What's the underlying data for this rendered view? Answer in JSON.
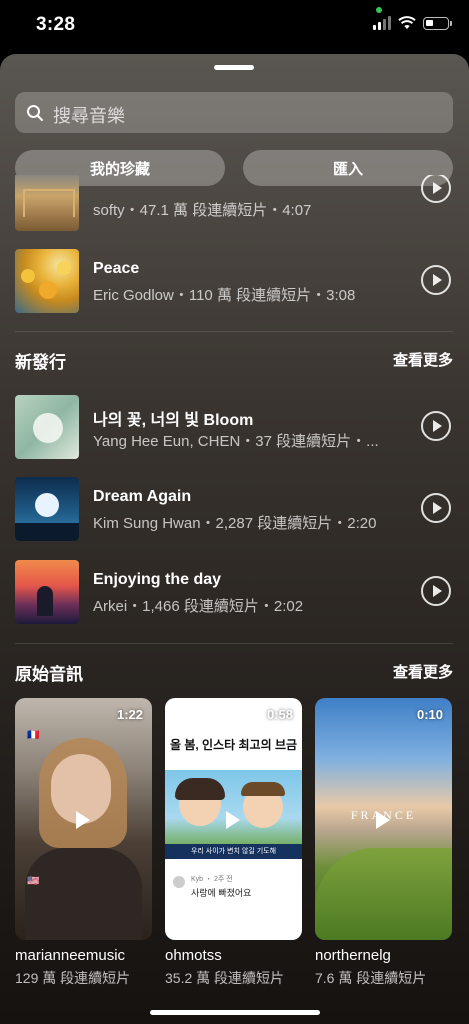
{
  "status": {
    "time": "3:28"
  },
  "search": {
    "placeholder": "搜尋音樂"
  },
  "segments": {
    "favorites": "我的珍藏",
    "import": "匯入"
  },
  "top_tracks": [
    {
      "title": "",
      "subtitle": "softy・47.1 萬 段連續短片・4:07"
    },
    {
      "title": "Peace",
      "subtitle": "Eric Godlow・110 萬 段連續短片・3:08"
    }
  ],
  "new_releases": {
    "title": "新發行",
    "see_more": "查看更多",
    "tracks": [
      {
        "title": "나의 꽃, 너의 빛 Bloom",
        "subtitle": "Yang Hee Eun, CHEN・37 段連續短片・..."
      },
      {
        "title": "Dream Again",
        "subtitle": "Kim Sung Hwan・2,287 段連續短片・2:20"
      },
      {
        "title": "Enjoying the day",
        "subtitle": "Arkei・1,466 段連續短片・2:02"
      }
    ]
  },
  "original_audio": {
    "title": "原始音訊",
    "see_more": "查看更多",
    "reels": [
      {
        "duration": "1:22",
        "name": "marianneemusic",
        "count": "129 萬 段連續短片",
        "flag_top": "🇫🇷",
        "flag_bottom": "🇺🇸"
      },
      {
        "duration": "0:58",
        "name": "ohmotss",
        "count": "35.2 萬 段連續短片",
        "headline": "올 봄, 인스타 최고의 브금",
        "caption": "우리 사이가 변치 않길 기도해",
        "comment": "사랑에 빠졌어요",
        "comment_user": "Kyb ・ 2주 전"
      },
      {
        "duration": "0:10",
        "name": "northernelg",
        "count": "7.6 萬 段連續短片",
        "overlay": "FRANCE"
      }
    ]
  },
  "icons": {
    "search": "search-icon",
    "play": "play-icon",
    "wifi": "wifi-icon",
    "battery": "battery-icon",
    "signal": "signal-icon"
  }
}
